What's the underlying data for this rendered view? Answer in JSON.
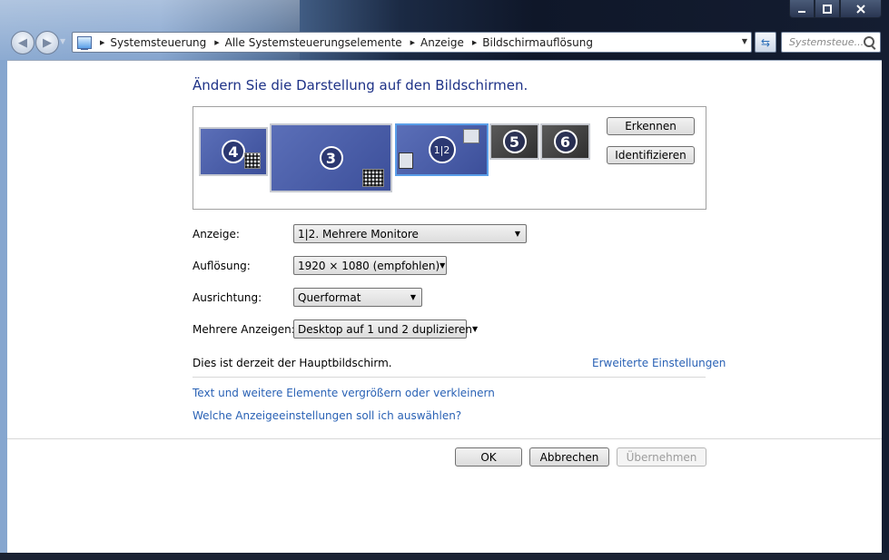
{
  "window": {
    "caption_icons": [
      "minimize-icon",
      "maximize-icon",
      "close-icon"
    ]
  },
  "address_bar": {
    "breadcrumbs": [
      "Systemsteuerung",
      "Alle Systemsteuerungselemente",
      "Anzeige",
      "Bildschirmauflösung"
    ]
  },
  "search": {
    "placeholder": "Systemsteue..."
  },
  "main": {
    "heading": "Ändern Sie die Darstellung auf den Bildschirmen.",
    "monitors": [
      {
        "label": "4"
      },
      {
        "label": "3"
      },
      {
        "label": "1|2"
      },
      {
        "label": "5"
      },
      {
        "label": "6"
      }
    ],
    "detect_button": "Erkennen",
    "identify_button": "Identifizieren",
    "fields": {
      "display_label": "Anzeige:",
      "display_value": "1|2. Mehrere Monitore",
      "resolution_label": "Auflösung:",
      "resolution_value": "1920 × 1080 (empfohlen)",
      "orientation_label": "Ausrichtung:",
      "orientation_value": "Querformat",
      "multiple_label": "Mehrere Anzeigen:",
      "multiple_value": "Desktop auf 1 und 2 duplizieren"
    },
    "primary_note": "Dies ist derzeit der Hauptbildschirm.",
    "advanced_link": "Erweiterte Einstellungen",
    "links": [
      "Text und weitere Elemente vergrößern oder verkleinern",
      "Welche Anzeigeeinstellungen soll ich auswählen?"
    ]
  },
  "footer": {
    "ok": "OK",
    "cancel": "Abbrechen",
    "apply": "Übernehmen"
  },
  "colors": {
    "heading": "#1e3287",
    "link": "#2a62b5",
    "monitor_active": "#4a5fab",
    "monitor_inactive": "#3a3a3a"
  }
}
